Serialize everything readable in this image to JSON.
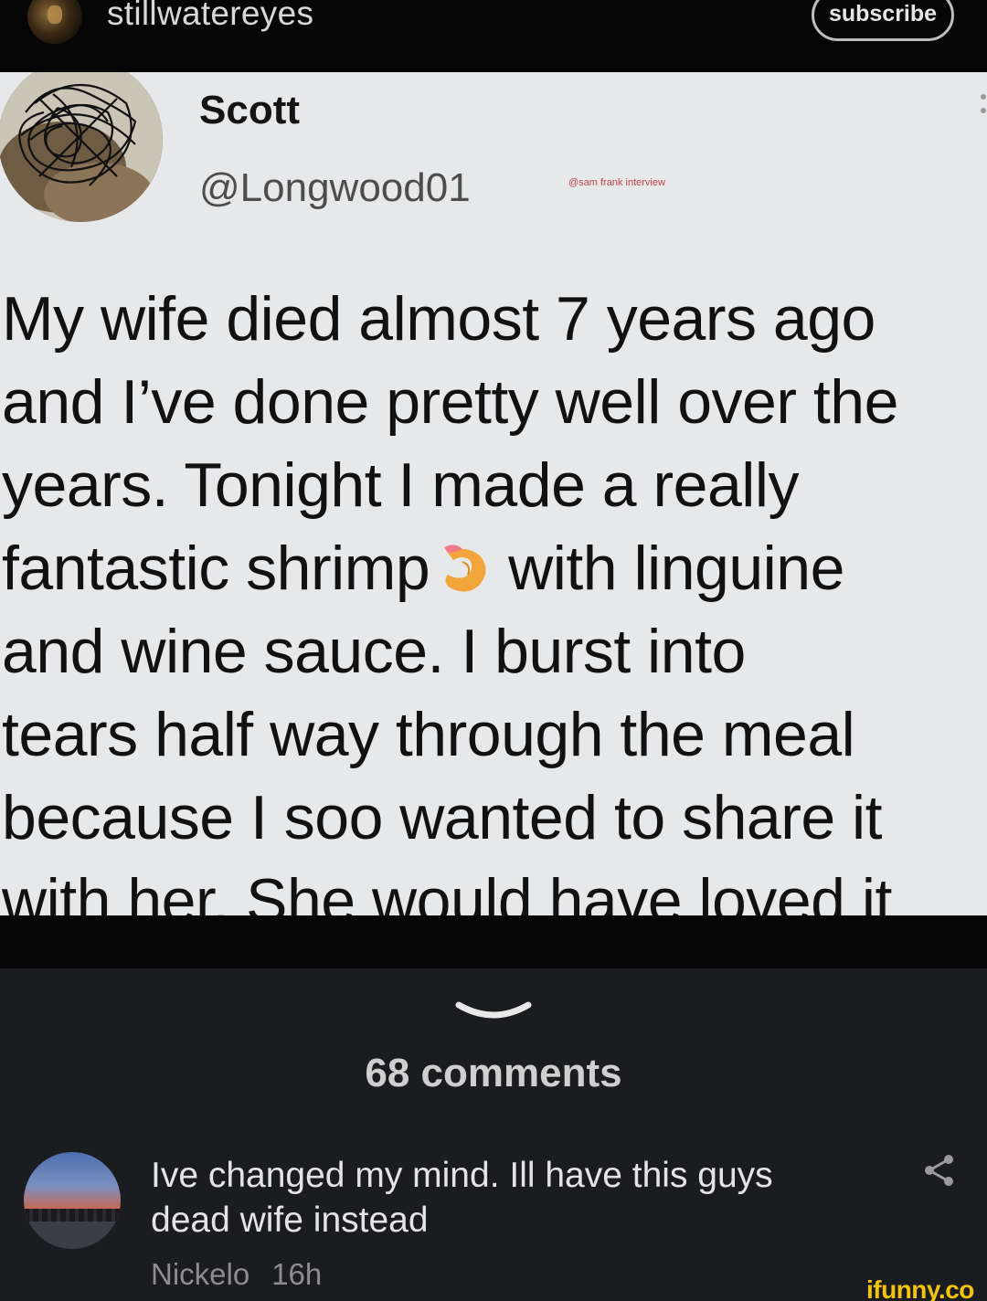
{
  "header": {
    "username": "stillwatereyes",
    "subscribe_label": "subscribe"
  },
  "post": {
    "tweet": {
      "name": "Scott",
      "handle": "@Longwood01",
      "watermark": "@sam frank interview",
      "lines": [
        "My wife died almost 7 years ago",
        "and I’ve done pretty well over the",
        "years. Tonight I made a really",
        "fantastic shrimp",
        "with linguine",
        "and wine sauce. I burst into",
        "tears half way through the meal",
        "because I soo wanted to share it",
        "with her. She would have loved it"
      ],
      "emoji": "shrimp-icon"
    }
  },
  "comments": {
    "count_label": "68 comments",
    "items": [
      {
        "text": "Ive changed my mind. Ill have this guys dead wife instead",
        "author": "Nickelo",
        "time": "16h"
      }
    ]
  },
  "footer": {
    "logo_text": "ifunny.co"
  },
  "colors": {
    "background": "#1b1c20",
    "topbar": "#060606",
    "tweet_background": "#e7e8ea",
    "logo": "#f2c30f"
  }
}
